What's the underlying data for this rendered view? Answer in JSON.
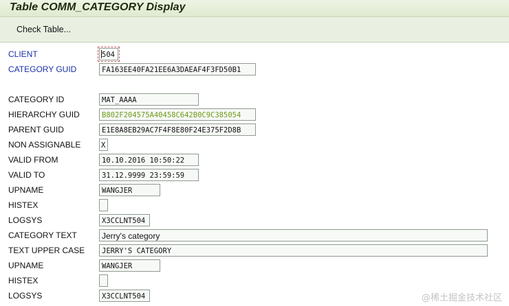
{
  "window": {
    "title": "Table COMM_CATEGORY Display"
  },
  "toolbar": {
    "check_table_label": "Check Table..."
  },
  "fields": {
    "client": {
      "label": "CLIENT",
      "value": "504"
    },
    "category_guid": {
      "label": "CATEGORY GUID",
      "value": "FA163EE40FA21EE6A3DAEAF4F3FD50B1"
    },
    "category_id": {
      "label": "CATEGORY ID",
      "value": "MAT_AAAA"
    },
    "hierarchy_guid": {
      "label": "HIERARCHY GUID",
      "value": "B802F204575A40458C642B0C9C385054"
    },
    "parent_guid": {
      "label": "PARENT GUID",
      "value": "E1E8A8EB29AC7F4F8E80F24E375F2D8B"
    },
    "non_assignable": {
      "label": "NON ASSIGNABLE",
      "value": "X"
    },
    "valid_from": {
      "label": "VALID FROM",
      "value": "10.10.2016 10:50:22"
    },
    "valid_to": {
      "label": "VALID TO",
      "value": "31.12.9999 23:59:59"
    },
    "upname_1": {
      "label": "UPNAME",
      "value": "WANGJER"
    },
    "histex_1": {
      "label": "HISTEX",
      "value": ""
    },
    "logsys_1": {
      "label": "LOGSYS",
      "value": "X3CCLNT504"
    },
    "category_text": {
      "label": "CATEGORY TEXT",
      "value": "Jerry's category"
    },
    "text_upper_case": {
      "label": "TEXT UPPER CASE",
      "value": "JERRY'S CATEGORY"
    },
    "upname_2": {
      "label": "UPNAME",
      "value": "WANGJER"
    },
    "histex_2": {
      "label": "HISTEX",
      "value": ""
    },
    "logsys_2": {
      "label": "LOGSYS",
      "value": "X3CCLNT504"
    }
  },
  "watermark": "@稀土掘金技术社区",
  "colors": {
    "title_bar": "#dfe9d0",
    "toolbar": "#e9f0e2",
    "key_label": "#1a2ea8",
    "hierarchy_value": "#6e9a1a"
  }
}
